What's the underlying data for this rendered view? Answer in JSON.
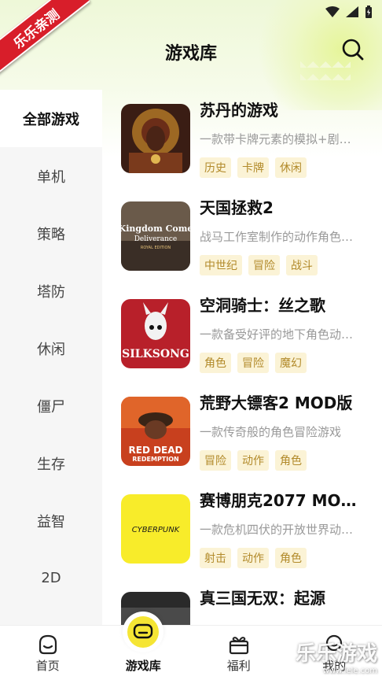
{
  "header": {
    "title": "游戏库",
    "badge": "乐乐亲测"
  },
  "sidebar": {
    "items": [
      {
        "label": "全部游戏",
        "active": true
      },
      {
        "label": "单机"
      },
      {
        "label": "策略"
      },
      {
        "label": "塔防"
      },
      {
        "label": "休闲"
      },
      {
        "label": "僵尸"
      },
      {
        "label": "生存"
      },
      {
        "label": "益智"
      },
      {
        "label": "2D"
      }
    ]
  },
  "games": [
    {
      "title": "苏丹的游戏",
      "desc": "一款带卡牌元素的模拟+剧…",
      "tags": [
        "历史",
        "卡牌",
        "休闲"
      ]
    },
    {
      "title": "天国拯救2",
      "desc": "战马工作室制作的动作角色…",
      "tags": [
        "中世纪",
        "冒险",
        "战斗"
      ],
      "art": {
        "line1": "Kingdom Come",
        "line2": "Deliverance",
        "line3": "ROYAL EDITION"
      }
    },
    {
      "title": "空洞骑士：丝之歌",
      "desc": "一款备受好评的地下角色动…",
      "tags": [
        "角色",
        "冒险",
        "魔幻"
      ],
      "art": {
        "line1": "SILKSONG"
      }
    },
    {
      "title": "荒野大镖客2 MOD版",
      "desc": "一款传奇般的角色冒险游戏",
      "tags": [
        "冒险",
        "动作",
        "角色"
      ],
      "art": {
        "line1": "RED DEAD",
        "line2": "REDEMPTION"
      }
    },
    {
      "title": "赛博朋克2077 MOD…",
      "desc": "一款危机四伏的开放世界动…",
      "tags": [
        "射击",
        "动作",
        "角色"
      ],
      "art": {
        "line1": "CYBERPUNK"
      }
    },
    {
      "title": "真三国无双：起源",
      "desc": "",
      "tags": []
    }
  ],
  "nav": {
    "items": [
      {
        "label": "首页",
        "icon": "home-face-icon"
      },
      {
        "label": "游戏库",
        "icon": "gamepad-icon",
        "active": true
      },
      {
        "label": "福利",
        "icon": "gift-icon"
      },
      {
        "label": "我的",
        "icon": "profile-icon"
      }
    ]
  },
  "watermark": {
    "text": "乐乐游戏",
    "url": "www.lele.com"
  },
  "colors": {
    "accent": "#f5e534",
    "tag_bg": "#fbf3d6",
    "tag_text": "#b28a2a",
    "badge": "#d81e2a"
  }
}
